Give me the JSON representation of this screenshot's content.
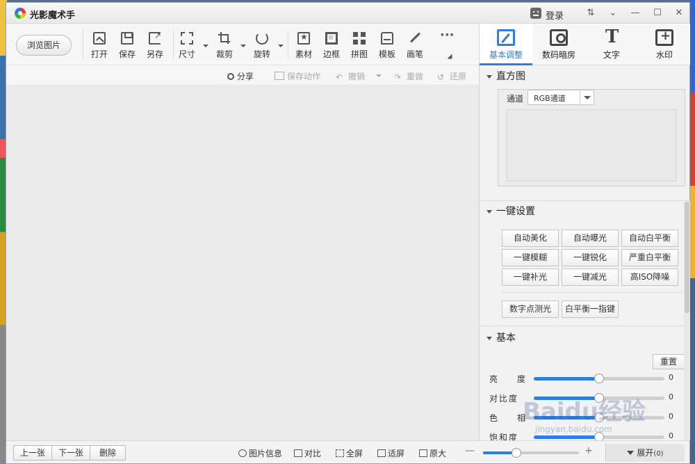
{
  "window": {
    "title": "光影魔术手",
    "login_label": "登录",
    "controls": [
      "⇅",
      "⌄",
      "—",
      "☐",
      "✕"
    ]
  },
  "toolbar": {
    "browse_label": "浏览图片",
    "tools": [
      {
        "label": "打开",
        "icon": "open-image-icon"
      },
      {
        "label": "保存",
        "icon": "save-icon"
      },
      {
        "label": "另存",
        "icon": "save-as-icon"
      },
      {
        "label": "尺寸",
        "icon": "resize-icon"
      },
      {
        "label": "裁剪",
        "icon": "crop-icon"
      },
      {
        "label": "旋转",
        "icon": "rotate-icon"
      },
      {
        "label": "素材",
        "icon": "material-icon"
      },
      {
        "label": "边框",
        "icon": "border-icon"
      },
      {
        "label": "拼图",
        "icon": "collage-icon"
      },
      {
        "label": "模板",
        "icon": "template-icon"
      },
      {
        "label": "画笔",
        "icon": "brush-icon"
      },
      {
        "label": "...",
        "icon": "more-icon"
      }
    ]
  },
  "actions": {
    "share": "分享",
    "save_action": "保存动作",
    "undo": "撤销",
    "redo": "重做",
    "restore": "还原"
  },
  "right_panel": {
    "tabs": [
      {
        "label": "基本调整",
        "icon": "basic-adjust-icon",
        "active": true
      },
      {
        "label": "数码暗房",
        "icon": "digital-darkroom-icon",
        "active": false
      },
      {
        "label": "文字",
        "icon": "text-icon",
        "active": false
      },
      {
        "label": "水印",
        "icon": "watermark-icon",
        "active": false
      }
    ],
    "histogram": {
      "title": "直方图",
      "channel_label": "通道",
      "channel_value": "RGB通道"
    },
    "one_click": {
      "title": "一键设置",
      "buttons": [
        "自动美化",
        "自动曝光",
        "自动白平衡",
        "一键模糊",
        "一键锐化",
        "严重白平衡",
        "一键补光",
        "一键减光",
        "高ISO降噪"
      ],
      "extra_buttons": [
        "数字点测光",
        "白平衡一指键"
      ]
    },
    "basic": {
      "title": "基本",
      "reset_label": "重置",
      "sliders": [
        {
          "label": "亮　度",
          "value": "0",
          "level": 0.5
        },
        {
          "label": "对比度",
          "value": "0",
          "level": 0.5
        },
        {
          "label": "色　相",
          "value": "0",
          "level": 0.5
        },
        {
          "label": "饱和度",
          "value": "0",
          "level": 0.5
        }
      ]
    }
  },
  "bottom": {
    "prev": "上一张",
    "next": "下一张",
    "delete": "删除",
    "image_info": "图片信息",
    "compare": "对比",
    "fullscreen": "全屏",
    "fit": "适屏",
    "original": "原大",
    "zoom_minus": "—",
    "zoom_plus": "+",
    "zoom_level": 0.35,
    "expand": "展开",
    "expand_count": "(0)"
  },
  "watermark": {
    "main": "Baidu经验",
    "sub": "jingyan.baidu.com"
  },
  "colors": {
    "accent": "#2c7ee0",
    "canvas": "#ebebeb"
  }
}
